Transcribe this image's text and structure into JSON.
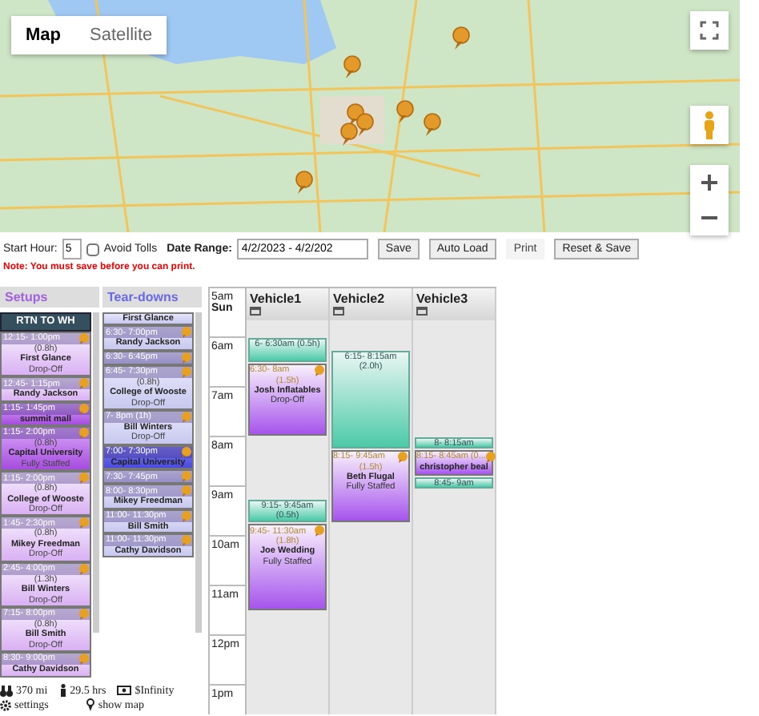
{
  "map": {
    "tabs": [
      {
        "label": "Map",
        "selected": true
      },
      {
        "label": "Satellite",
        "selected": false
      }
    ]
  },
  "controls": {
    "start_hour_label": "Start Hour:",
    "start_hour": "5",
    "avoid_tolls": {
      "label": "Avoid Tolls",
      "checked": false
    },
    "date_range_label": "Date Range:",
    "date_range": "4/2/2023 - 4/2/202",
    "buttons": [
      {
        "label": "Save",
        "disabled": false
      },
      {
        "label": "Auto Load",
        "disabled": false
      },
      {
        "label": "Print",
        "disabled": true
      },
      {
        "label": "Reset & Save",
        "disabled": false
      }
    ]
  },
  "note": "Note: You must save before you can print.",
  "setups": {
    "title": "Setups",
    "items": [
      {
        "kind": "return",
        "time": "RTN TO WH"
      },
      {
        "kind": "job",
        "time": "12:15- 1:00pm",
        "duration": "(0.8h)",
        "name": "First Glance",
        "status": "Drop-Off"
      },
      {
        "kind": "job",
        "time": "12:45- 1:15pm",
        "name": "Randy Jackson"
      },
      {
        "kind": "staffed",
        "time": "1:15- 1:45pm",
        "name": "summit mall"
      },
      {
        "kind": "staffed",
        "time": "1:15- 2:00pm",
        "duration": "(0.8h)",
        "name": "Capital University",
        "status": "Fully Staffed"
      },
      {
        "kind": "job",
        "time": "1:15- 2:00pm",
        "duration": "(0.8h)",
        "name": "College of Wooste",
        "status": "Drop-Off"
      },
      {
        "kind": "job",
        "time": "1:45- 2:30pm",
        "duration": "(0.8h)",
        "name": "Mikey Freedman",
        "status": "Drop-Off"
      },
      {
        "kind": "job",
        "time": "2:45- 4:00pm",
        "duration": "(1.3h)",
        "name": "Bill Winters",
        "status": "Drop-Off"
      },
      {
        "kind": "job",
        "time": "7:15- 8:00pm",
        "duration": "(0.8h)",
        "name": "Bill Smith",
        "status": "Drop-Off"
      },
      {
        "kind": "job",
        "time": "8:30- 9:00pm",
        "name": "Cathy Davidson"
      }
    ]
  },
  "teardowns": {
    "title": "Tear-downs",
    "items": [
      {
        "kind": "job",
        "name": "First Glance"
      },
      {
        "kind": "job",
        "time": "6:30- 7:00pm",
        "name": "Randy Jackson"
      },
      {
        "kind": "job",
        "time": "6:30- 6:45pm"
      },
      {
        "kind": "job",
        "time": "6:45- 7:30pm",
        "duration": "(0.8h)",
        "name": "College of Wooste",
        "status": "Drop-Off"
      },
      {
        "kind": "job",
        "time": "7- 8pm (1h)",
        "name": "Bill Winters",
        "status": "Drop-Off"
      },
      {
        "kind": "staffed",
        "time": "7:00- 7:30pm",
        "name": "Capital University"
      },
      {
        "kind": "job",
        "time": "7:30- 7:45pm"
      },
      {
        "kind": "job",
        "time": "8:00- 8:30pm",
        "name": "Mikey Freedman"
      },
      {
        "kind": "job",
        "time": "11:00- 11:30pm",
        "name": "Bill Smith"
      },
      {
        "kind": "job",
        "time": "11:00- 11:30pm",
        "name": "Cathy Davidson"
      }
    ]
  },
  "summary": {
    "distance": "370 mi",
    "hours": "29.5 hrs",
    "cost": "$Infinity",
    "settings": "settings",
    "show_map": "show map"
  },
  "calendar": {
    "time_header": "5am",
    "day": "Sun",
    "hours": [
      "6am",
      "7am",
      "8am",
      "9am",
      "10am",
      "11am",
      "12pm",
      "1pm"
    ],
    "vehicles": [
      {
        "name": "Vehicle1",
        "events": [
          {
            "kind": "travel",
            "time": "6- 6:30am (0.5h)"
          },
          {
            "kind": "job",
            "time": "6:30- 8am",
            "duration": "(1.5h)",
            "name": "Josh Inflatables",
            "status": "Drop-Off"
          },
          {
            "kind": "travel",
            "time": "9:15- 9:45am",
            "duration": "(0.5h)"
          },
          {
            "kind": "job",
            "time": "9:45- 11:30am",
            "duration": "(1.8h)",
            "name": "Joe Wedding",
            "status": "Fully Staffed"
          }
        ]
      },
      {
        "name": "Vehicle2",
        "events": [
          {
            "kind": "travel",
            "time": "6:15- 8:15am",
            "duration": "(2.0h)"
          },
          {
            "kind": "job",
            "time": "8:15- 9:45am",
            "duration": "(1.5h)",
            "name": "Beth Flugal",
            "status": "Fully Staffed"
          }
        ]
      },
      {
        "name": "Vehicle3",
        "events": [
          {
            "kind": "travel",
            "time": "8- 8:15am"
          },
          {
            "kind": "job",
            "time": "8:15- 8:45am (0...",
            "name": "christopher beal"
          },
          {
            "kind": "travel",
            "time": "8:45- 9am"
          }
        ]
      }
    ]
  }
}
